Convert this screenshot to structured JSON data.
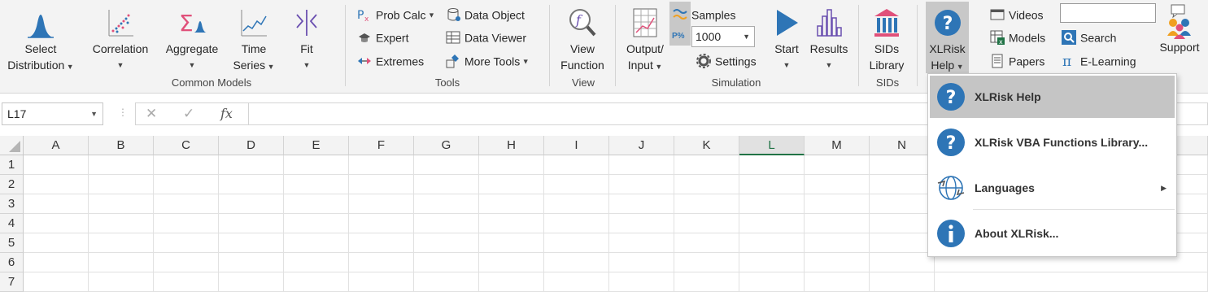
{
  "ribbon": {
    "select_distribution": [
      "Select",
      "Distribution"
    ],
    "correlation": "Correlation",
    "aggregate": "Aggregate",
    "time_series": [
      "Time",
      "Series"
    ],
    "fit": "Fit",
    "common_models_label": "Common Models",
    "tools": {
      "prob_calc": "Prob Calc",
      "expert": "Expert",
      "extremes": "Extremes",
      "data_object": "Data Object",
      "data_viewer": "Data Viewer",
      "more_tools": "More Tools",
      "label": "Tools"
    },
    "view": {
      "line1": "View",
      "line2": "Function",
      "label": "View"
    },
    "simulation": {
      "output_input": [
        "Output/",
        "Input"
      ],
      "samples": "Samples",
      "samples_value": "1000",
      "settings": "Settings",
      "start": "Start",
      "results": "Results",
      "label": "Simulation"
    },
    "sids": {
      "line1": "SIDs",
      "line2": "Library",
      "label": "SIDs"
    },
    "help": {
      "line1": "XLRisk",
      "line2": "Help"
    },
    "resources": {
      "videos": "Videos",
      "models": "Models",
      "papers": "Papers",
      "search": "Search",
      "elearning": "E-Learning",
      "support": "Support",
      "search_value": ""
    }
  },
  "formula_bar": {
    "name_box": "L17",
    "fx": "fx",
    "formula": ""
  },
  "grid": {
    "columns": [
      "A",
      "B",
      "C",
      "D",
      "E",
      "F",
      "G",
      "H",
      "I",
      "J",
      "K",
      "L",
      "M",
      "N"
    ],
    "selected_column": "L",
    "rows": [
      "1",
      "2",
      "3",
      "4",
      "5",
      "6",
      "7"
    ]
  },
  "help_menu": {
    "items": [
      {
        "label": "XLRisk Help",
        "icon": "question-icon"
      },
      {
        "label": "XLRisk VBA Functions Library...",
        "icon": "question-icon"
      },
      {
        "label": "Languages",
        "icon": "globe-icon"
      },
      {
        "label": "About XLRisk...",
        "icon": "info-icon"
      }
    ]
  },
  "colors": {
    "accent_blue": "#2e75b6",
    "excel_green": "#217346",
    "pink": "#e0507a"
  }
}
